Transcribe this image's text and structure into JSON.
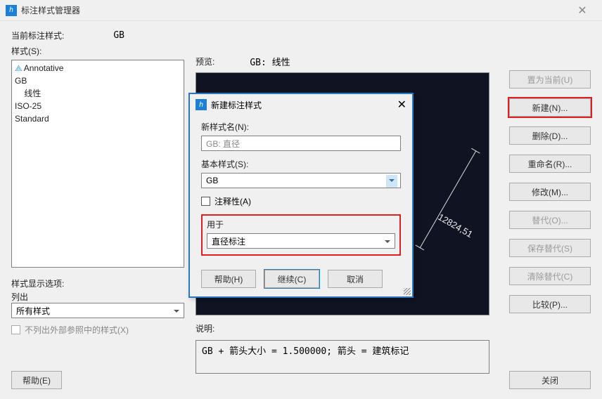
{
  "window": {
    "title": "标注样式管理器"
  },
  "current_style": {
    "label": "当前标注样式:",
    "value": "GB"
  },
  "styles": {
    "label": "样式(S):",
    "items": [
      "Annotative",
      "GB",
      "线性",
      "ISO-25",
      "Standard"
    ]
  },
  "preview": {
    "label": "预览:",
    "value": "GB: 线性",
    "dim_value": "12824,51"
  },
  "desc": {
    "label": "说明:",
    "text": "GB + 箭头大小  = 1.500000; 箭头 = 建筑标记"
  },
  "display_options": {
    "label": "样式显示选项:",
    "sub": "列出",
    "select": "所有样式",
    "no_xref": "不列出外部参照中的样式(X)"
  },
  "buttons": {
    "set_current": "置为当前(U)",
    "new": "新建(N)...",
    "delete": "删除(D)...",
    "rename": "重命名(R)...",
    "modify": "修改(M)...",
    "override": "替代(O)...",
    "save_override": "保存替代(S)",
    "clear_override": "清除替代(C)",
    "compare": "比较(P)...",
    "help": "帮助(E)",
    "close": "关闭"
  },
  "modal": {
    "title": "新建标注样式",
    "new_name": {
      "label": "新样式名(N):",
      "value": "GB: 直径"
    },
    "base_style": {
      "label": "基本样式(S):",
      "value": "GB"
    },
    "annotative": "注释性(A)",
    "use_for": {
      "label": "用于",
      "value": "直径标注"
    },
    "buttons": {
      "help": "帮助(H)",
      "continue": "继续(C)",
      "cancel": "取消"
    }
  }
}
